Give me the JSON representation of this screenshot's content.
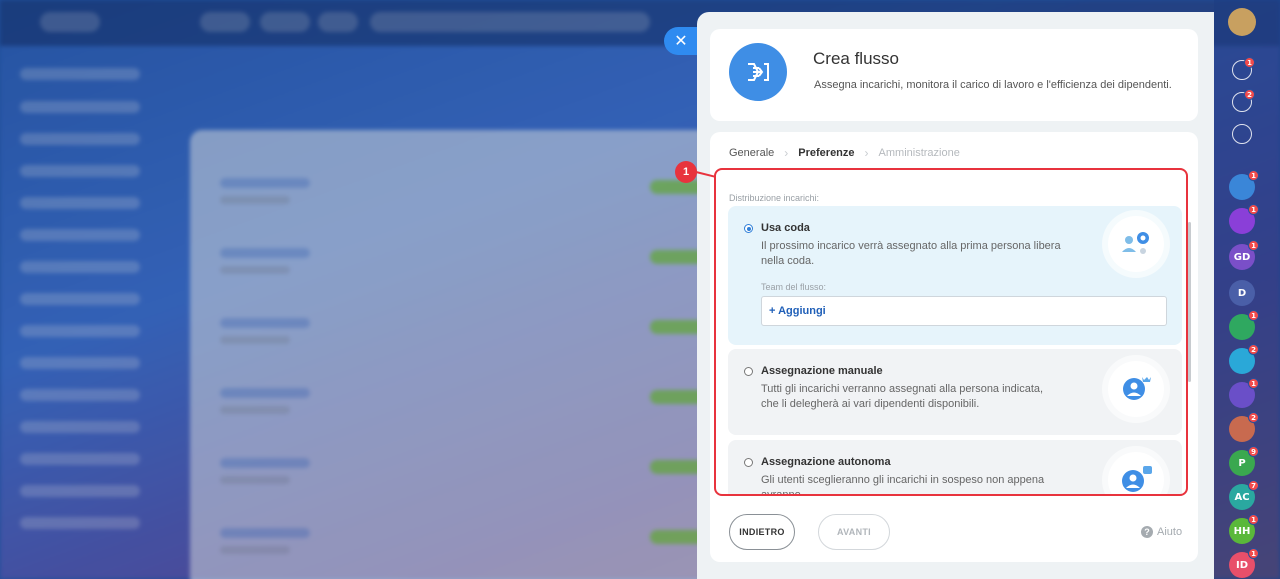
{
  "panel": {
    "title": "Crea flusso",
    "subtitle": "Assegna incarichi, monitora il carico di lavoro e l'efficienza dei dipendenti."
  },
  "steps": [
    {
      "label": "Generale",
      "state": "done"
    },
    {
      "label": "Preferenze",
      "state": "active"
    },
    {
      "label": "Amministrazione",
      "state": "disabled"
    }
  ],
  "section_label": "Distribuzione incarichi:",
  "options": [
    {
      "title": "Usa coda",
      "description": "Il prossimo incarico verrà assegnato alla prima persona libera nella coda.",
      "selected": true,
      "team_label": "Team del flusso:",
      "add_label": "+ Aggiungi"
    },
    {
      "title": "Assegnazione manuale",
      "description": "Tutti gli incarichi verranno assegnati alla persona indicata, che li delegherà ai vari dipendenti disponibili.",
      "selected": false
    },
    {
      "title": "Assegnazione autonoma",
      "description": "Gli utenti sceglieranno gli incarichi in sospeso non appena avranno",
      "selected": false
    }
  ],
  "footer": {
    "back_label": "INDIETRO",
    "next_label": "AVANTI",
    "help_label": "Aiuto"
  },
  "annotation": {
    "number": "1"
  },
  "rightbar": [
    {
      "name": "notification-bell",
      "badge": "1",
      "color": "transparent"
    },
    {
      "name": "activity-icon",
      "badge": "2",
      "color": "transparent"
    },
    {
      "name": "chat-icon",
      "badge": "",
      "color": "transparent"
    },
    {
      "name": "group-chat-1",
      "badge": "1",
      "color": "#3a86d8"
    },
    {
      "name": "group-chat-2",
      "badge": "1",
      "color": "#8a3fd8",
      "text": ""
    },
    {
      "name": "group-chat-gd",
      "badge": "1",
      "color": "#7a4fc8",
      "text": "GD"
    },
    {
      "name": "group-chat-d",
      "badge": "",
      "color": "#4a5fa8",
      "text": "D"
    },
    {
      "name": "group-chat-3",
      "badge": "1",
      "color": "#2fa860"
    },
    {
      "name": "group-chat-4",
      "badge": "2",
      "color": "#2aa8d8"
    },
    {
      "name": "group-chat-5",
      "badge": "1",
      "color": "#6a4fc8"
    },
    {
      "name": "group-chat-6",
      "badge": "2",
      "color": "#c86a4f"
    },
    {
      "name": "user-p",
      "badge": "9",
      "color": "#3aa84f",
      "text": "P"
    },
    {
      "name": "user-ac",
      "badge": "7",
      "color": "#2aa8a0",
      "text": "AC"
    },
    {
      "name": "user-hh",
      "badge": "1",
      "color": "#5ab83a",
      "text": "HH"
    },
    {
      "name": "user-id",
      "badge": "1",
      "color": "#e84f6a",
      "text": "ID"
    }
  ]
}
